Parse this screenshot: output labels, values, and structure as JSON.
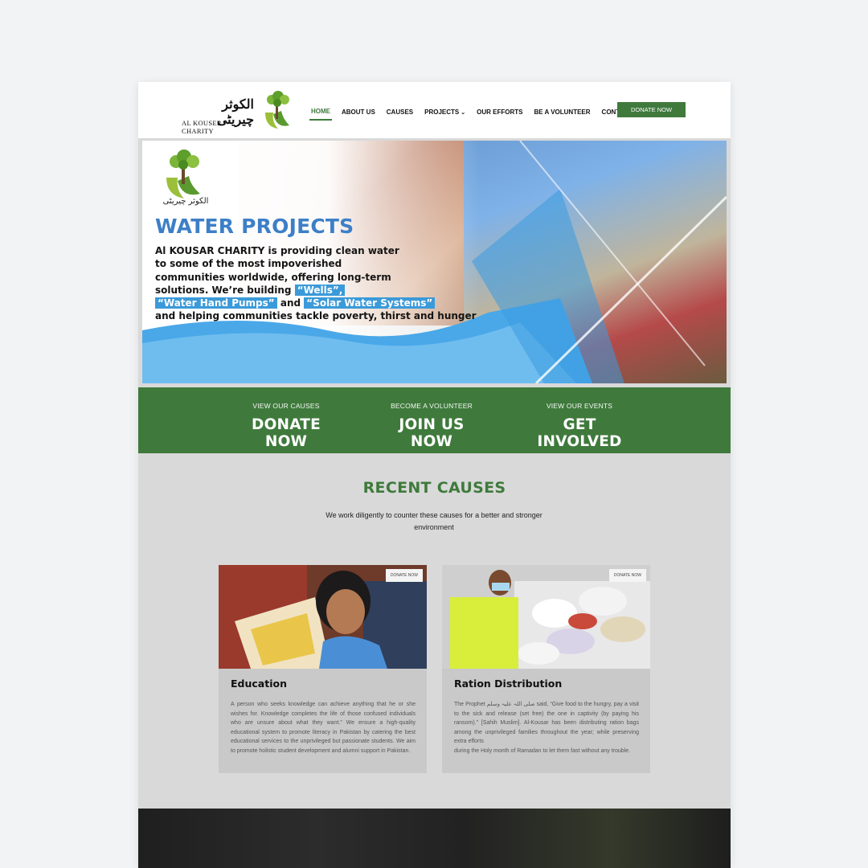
{
  "header": {
    "logo_urdu": "الکوثر چیریٹی",
    "logo_en": "AL KOUSER CHARITY",
    "nav": [
      {
        "label": "HOME"
      },
      {
        "label": "ABOUT US"
      },
      {
        "label": "CAUSES"
      },
      {
        "label": "PROJECTS"
      },
      {
        "label": "OUR EFFORTS"
      },
      {
        "label": "BE A VOLUNTEER"
      },
      {
        "label": "CONTACT"
      }
    ],
    "donate_label": "DONATE NOW"
  },
  "hero": {
    "logo_urdu": "الکوثر چیریٹی",
    "title": "WATER PROJECTS",
    "line1": "Al KOUSAR CHARITY is providing clean water",
    "line2": "to some of the most impoverished",
    "line3": "communities worldwide, offering long-term",
    "line4": "solutions. We’re building",
    "hl_wells": "“Wells”,",
    "hl_pumps": "“Water Hand Pumps”",
    "and": "and",
    "hl_solar": "“Solar Water Systems”",
    "line6": "and helping communities tackle poverty, thirst and hunger"
  },
  "band": [
    {
      "small": "VIEW OUR CAUSES",
      "big": "DONATE NOW"
    },
    {
      "small": "BECOME A VOLUNTEER",
      "big": "JOIN US NOW"
    },
    {
      "small": "VIEW OUR EVENTS",
      "big": "GET INVOLVED"
    }
  ],
  "recent_causes": {
    "title": "RECENT CAUSES",
    "subtitle": "We work diligently to counter these causes for a better and stronger environment",
    "cards": [
      {
        "tag": "DONATE NOW",
        "title": "Education",
        "text": "A person who seeks knowledge can achieve anything that he or she wishes for. Knowledge completes the life of those confused individuals who are unsure about what they want.” We ensure a high-quality educational system to promote literacy in Pakistan by catering the best educational services to the unprivileged but passionate students. We aim to promote holistic student development and alumni support in Pakistan."
      },
      {
        "tag": "DONATE NOW",
        "title": "Ration Distribution",
        "text": "The Prophet صلی اللہ علیہ وسلم said, “Give food to the hungry, pay a visit to the sick and release (set free) the one in captivity (by paying his ransom).” [Sahih Muslim]. Al-Kousar has been distributing ration bags among the unprivileged families throughout the year; while preserving extra efforts",
        "text2": "during the Holy month of Ramadan to let them fast without any trouble."
      }
    ]
  },
  "colors": {
    "green": "#3f7a3c",
    "blue_title": "#3d7fc7",
    "highlight": "#3b9ad9"
  }
}
